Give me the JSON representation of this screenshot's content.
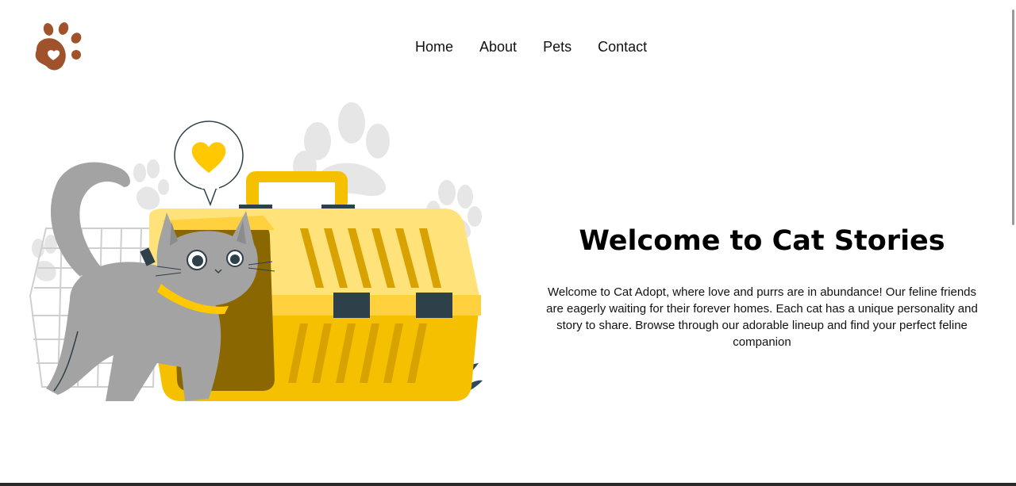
{
  "brand": {
    "logo_icon": "paw-print-icon",
    "logo_color": "#a0522d"
  },
  "nav": {
    "items": [
      {
        "label": "Home"
      },
      {
        "label": "About"
      },
      {
        "label": "Pets"
      },
      {
        "label": "Contact"
      }
    ]
  },
  "hero": {
    "illustration_icon": "cat-carrier-illustration",
    "title": "Welcome to Cat Stories",
    "description": "Welcome to Cat Adopt, where love and purrs are in abundance! Our feline friends are eagerly waiting for their forever homes. Each cat has a unique personality and story to share. Browse through our adorable lineup and find your perfect feline companion"
  },
  "colors": {
    "accent_yellow": "#f5c000",
    "cat_gray": "#a3a3a3",
    "heart": "#ffc800"
  }
}
